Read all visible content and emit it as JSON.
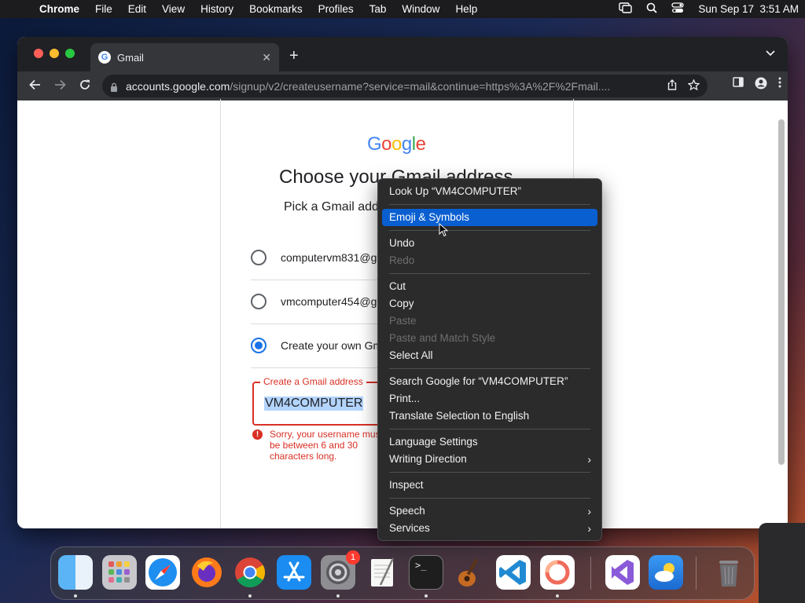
{
  "menubar": {
    "app": "Chrome",
    "items": [
      "File",
      "Edit",
      "View",
      "History",
      "Bookmarks",
      "Profiles",
      "Tab",
      "Window",
      "Help"
    ],
    "datetime": "Sun Sep 17  3:51 AM"
  },
  "browser": {
    "tab_title": "Gmail",
    "url_host": "accounts.google.com",
    "url_path": "/signup/v2/createusername?service=mail&continue=https%3A%2F%2Fmail...."
  },
  "page": {
    "logo": [
      "G",
      "o",
      "o",
      "g",
      "l",
      "e"
    ],
    "heading": "Choose your Gmail address",
    "subheading": "Pick a Gmail address or create your own",
    "options": [
      {
        "label": "computervm831@gmail.com",
        "selected": false
      },
      {
        "label": "vmcomputer454@gmail.com",
        "selected": false
      },
      {
        "label": "Create your own Gmail address",
        "selected": true
      }
    ],
    "field_label": "Create a Gmail address",
    "field_value": "VM4COMPUTER",
    "error_text": "Sorry, your username must be between 6 and 30 characters long."
  },
  "context_menu": {
    "look_up": "Look Up “VM4COMPUTER”",
    "emoji": "Emoji & Symbols",
    "undo": "Undo",
    "redo": "Redo",
    "cut": "Cut",
    "copy": "Copy",
    "paste": "Paste",
    "paste_match": "Paste and Match Style",
    "select_all": "Select All",
    "search_google": "Search Google for “VM4COMPUTER”",
    "print": "Print...",
    "translate": "Translate Selection to English",
    "language_settings": "Language Settings",
    "writing_direction": "Writing Direction",
    "inspect": "Inspect",
    "speech": "Speech",
    "services": "Services"
  },
  "dock": {
    "settings_badge": "1",
    "terminal_prompt": ">_"
  }
}
